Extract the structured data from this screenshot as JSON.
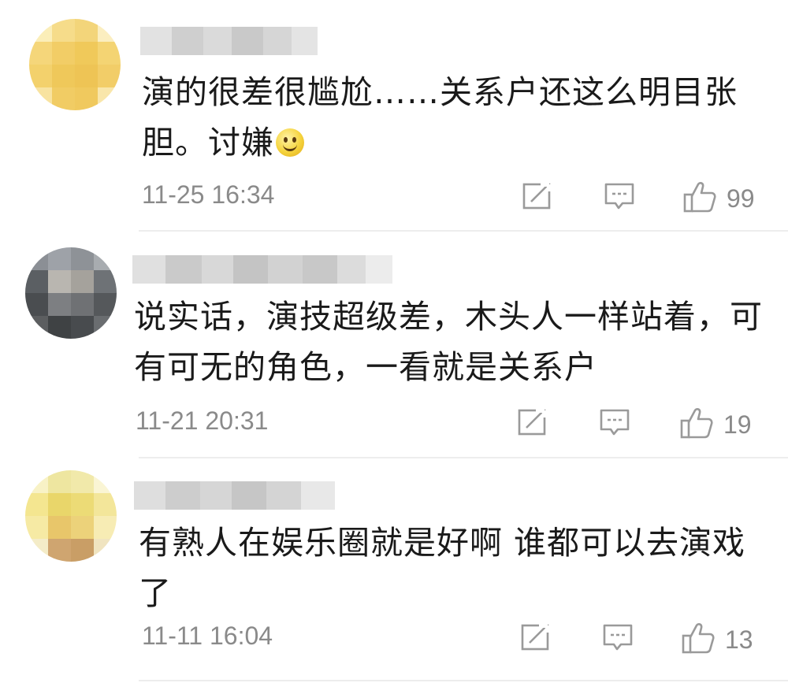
{
  "comments": [
    {
      "content_lines": [
        "演的很差很尴尬……关系户还这么明目张",
        "胆。讨嫌"
      ],
      "time": "11-25 16:34",
      "likes": "99",
      "has_smiley": true
    },
    {
      "content_lines": [
        "说实话，演技超级差，木头人一样站着，可",
        "有可无的角色，一看就是关系户"
      ],
      "time": "11-21 20:31",
      "likes": "19"
    },
    {
      "content_lines": [
        "有熟人在娱乐圈就是好啊 谁都可以去演戏",
        "了"
      ],
      "time": "11-11 16:04",
      "likes": "13"
    }
  ],
  "icons": {
    "share": "share-icon",
    "comment": "comment-icon",
    "like": "thumbs-up-icon",
    "emoji": "smiley-icon"
  },
  "colors": {
    "meta_text": "#8a8a8a",
    "icon": "#9a9a9a",
    "divider": "#ededed"
  }
}
